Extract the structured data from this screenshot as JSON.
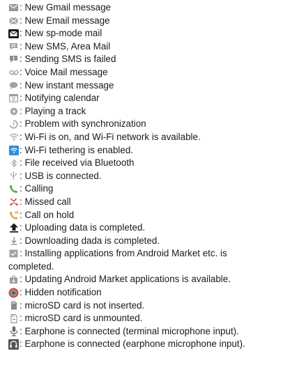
{
  "items": [
    {
      "icon": "gmail-envelope-icon",
      "label": ": New Gmail message"
    },
    {
      "icon": "email-envelope-icon",
      "label": ": New Email message"
    },
    {
      "icon": "sp-mode-mail-icon",
      "label": ": New sp-mode mail"
    },
    {
      "icon": "sms-bubble-icon",
      "label": ": New SMS, Area Mail"
    },
    {
      "icon": "sms-failed-icon",
      "label": ": Sending SMS is failed"
    },
    {
      "icon": "voicemail-icon",
      "label": ": Voice Mail message"
    },
    {
      "icon": "instant-message-icon",
      "label": ": New instant message"
    },
    {
      "icon": "calendar-icon",
      "label": ": Notifying calendar"
    },
    {
      "icon": "playing-track-icon",
      "label": ": Playing a track"
    },
    {
      "icon": "sync-problem-icon",
      "label": ": Problem with synchronization"
    },
    {
      "icon": "wifi-available-icon",
      "label": ": Wi-Fi is on, and Wi-Fi network is available."
    },
    {
      "icon": "wifi-tethering-icon",
      "label": ": Wi-Fi tethering is enabled."
    },
    {
      "icon": "bluetooth-received-icon",
      "label": ": File received via Bluetooth"
    },
    {
      "icon": "usb-icon",
      "label": ": USB is connected."
    },
    {
      "icon": "calling-icon",
      "label": ": Calling"
    },
    {
      "icon": "missed-call-icon",
      "label": ": Missed call"
    },
    {
      "icon": "call-on-hold-icon",
      "label": ": Call on hold"
    },
    {
      "icon": "upload-complete-icon",
      "label": ": Uploading data is completed."
    },
    {
      "icon": "download-complete-icon",
      "label": ": Downloading dada is completed."
    },
    {
      "icon": "install-complete-icon",
      "label": ": Installing applications from Android Market etc. is",
      "label_cont": "completed."
    },
    {
      "icon": "market-update-icon",
      "label": ": Updating Android Market applications is available."
    },
    {
      "icon": "hidden-notification-icon",
      "label": ": Hidden notification"
    },
    {
      "icon": "sd-not-inserted-icon",
      "label": ": microSD card is not inserted."
    },
    {
      "icon": "sd-unmounted-icon",
      "label": ": microSD card is unmounted."
    },
    {
      "icon": "earphone-terminal-mic-icon",
      "label": ": Earphone is connected (terminal microphone input)."
    },
    {
      "icon": "earphone-mic-icon",
      "label": ": Earphone is connected (earphone microphone input)."
    }
  ]
}
